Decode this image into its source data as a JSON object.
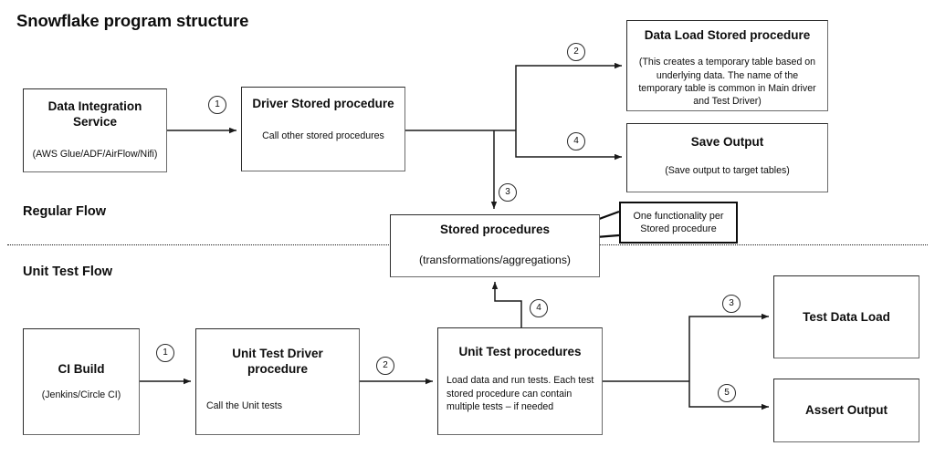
{
  "title": "Snowflake program structure",
  "sections": {
    "regular_flow": "Regular Flow",
    "unit_test_flow": "Unit Test Flow"
  },
  "nodes": {
    "data_integration": {
      "title": "Data Integration Service",
      "subtitle": "(AWS Glue/ADF/AirFlow/Nifi)"
    },
    "driver_stored": {
      "title": "Driver Stored procedure",
      "subtitle": "Call other stored procedures"
    },
    "data_load": {
      "title": "Data Load Stored procedure",
      "subtitle": "(This creates a temporary table based on underlying data. The name of the temporary table is common in Main driver and Test Driver)"
    },
    "save_output": {
      "title": "Save Output",
      "subtitle": "(Save output to target tables)"
    },
    "stored_procedures": {
      "title": "Stored procedures",
      "subtitle": "(transformations/aggregations)"
    },
    "ci_build": {
      "title": "CI Build",
      "subtitle": "(Jenkins/Circle CI)"
    },
    "unit_test_driver": {
      "title": "Unit Test Driver procedure",
      "subtitle": "Call the Unit tests"
    },
    "unit_test_procedures": {
      "title": "Unit Test procedures",
      "subtitle": "Load data and run tests. Each test stored procedure can contain multiple tests – if needed"
    },
    "test_data_load": {
      "title": "Test Data Load",
      "subtitle": ""
    },
    "assert_output": {
      "title": "Assert Output",
      "subtitle": ""
    }
  },
  "callout": {
    "text": "One functionality per Stored procedure"
  },
  "steps": {
    "regular_1": "1",
    "regular_2": "2",
    "regular_3": "3",
    "regular_4": "4",
    "test_1": "1",
    "test_2": "2",
    "test_3": "3",
    "test_4": "4",
    "test_5": "5"
  },
  "colors": {
    "stroke": "#1a1a1a",
    "box_border": "#2b2b2b",
    "box_shadow_edge": "#6a6a6a",
    "background": "#ffffff",
    "text": "#0d0d0d"
  }
}
